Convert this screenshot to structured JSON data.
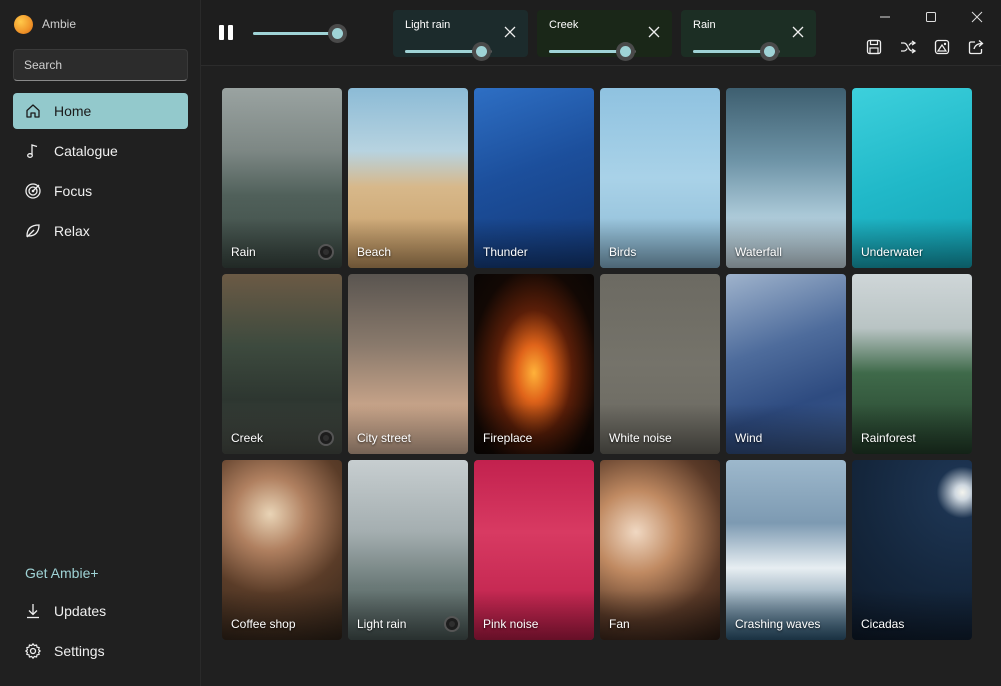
{
  "app": {
    "title": "Ambie"
  },
  "search": {
    "placeholder": "Search"
  },
  "nav": {
    "items": [
      {
        "label": "Home",
        "icon": "home-icon",
        "active": true
      },
      {
        "label": "Catalogue",
        "icon": "music-note-icon",
        "active": false
      },
      {
        "label": "Focus",
        "icon": "target-icon",
        "active": false
      },
      {
        "label": "Relax",
        "icon": "leaf-icon",
        "active": false
      }
    ],
    "get_plus": "Get Ambie+",
    "updates": "Updates",
    "settings": "Settings"
  },
  "player": {
    "state": "playing",
    "master_volume": 0.95,
    "active_sounds": [
      {
        "label": "Light rain",
        "volume": 0.87
      },
      {
        "label": "Creek",
        "volume": 0.87
      },
      {
        "label": "Rain",
        "volume": 0.87
      }
    ]
  },
  "colors": {
    "accent": "#93c9cc",
    "accent_light": "#9fd3d6",
    "background": "#202020"
  },
  "sounds": [
    {
      "name": "Rain",
      "playing": true,
      "bg": "linear-gradient(180deg,#9aa3a1 0%,#7d8784 35%,#50605a 60%,#3c4a44 100%)"
    },
    {
      "name": "Beach",
      "playing": false,
      "bg": "linear-gradient(180deg,#8cbbd6 0%,#b7d3e0 35%,#d7b88a 55%,#c69a63 100%)"
    },
    {
      "name": "Thunder",
      "playing": false,
      "bg": "linear-gradient(160deg,#2e6fc4 0%,#1c4f9c 45%,#143a7a 100%)"
    },
    {
      "name": "Birds",
      "playing": false,
      "bg": "linear-gradient(180deg,#8fc2e0 0%,#a9d2e8 50%,#8bb9d4 100%)"
    },
    {
      "name": "Waterfall",
      "playing": false,
      "bg": "linear-gradient(180deg,#3e5f70 0%,#6d93a6 40%,#a9c7d6 70%,#cfe1ea 100%)"
    },
    {
      "name": "Underwater",
      "playing": false,
      "bg": "linear-gradient(160deg,#3dd0dc 0%,#21b9c9 50%,#13a3b5 100%)"
    },
    {
      "name": "Creek",
      "playing": true,
      "bg": "linear-gradient(180deg,#6b5a45 0%,#3d4a3e 40%,#2d3630 70%,#4a4f48 100%)"
    },
    {
      "name": "City street",
      "playing": false,
      "bg": "linear-gradient(180deg,#5a5550 0%,#8a7a6c 40%,#c9a58a 75%,#d6b49b 100%)"
    },
    {
      "name": "Fireplace",
      "playing": false,
      "bg": "radial-gradient(ellipse at 50% 55%,#ffb23a 0%,#e0641a 20%,#5a1e08 45%,#120804 75%,#0a0604 100%)"
    },
    {
      "name": "White noise",
      "playing": false,
      "bg": "linear-gradient(180deg,#6c6a62 0%,#75736a 50%,#6a6860 100%)"
    },
    {
      "name": "Wind",
      "playing": false,
      "bg": "linear-gradient(160deg,#9fb3cc 0%,#4e6c9c 40%,#2e4b80 70%,#3c5a8c 100%)"
    },
    {
      "name": "Rainforest",
      "playing": false,
      "bg": "linear-gradient(180deg,#cfd6d8 0%,#b9c4c4 30%,#3f6a4a 55%,#233e2a 100%)"
    },
    {
      "name": "Coffee shop",
      "playing": false,
      "bg": "radial-gradient(circle at 40% 30%,#e9d4b6 0%,#b08060 25%,#5a3c28 55%,#2e2218 100%)"
    },
    {
      "name": "Light rain",
      "playing": true,
      "bg": "linear-gradient(180deg,#c7ced0 0%,#a4aeb0 40%,#6b7a78 70%,#4a5856 100%)"
    },
    {
      "name": "Pink noise",
      "playing": false,
      "bg": "linear-gradient(180deg,#c2214e 0%,#d83a62 40%,#b81c47 100%)"
    },
    {
      "name": "Fan",
      "playing": false,
      "bg": "radial-gradient(circle at 30% 40%,#f0d8c2 0%,#c08a62 30%,#5a3a28 65%,#2a1a12 100%)"
    },
    {
      "name": "Crashing waves",
      "playing": false,
      "bg": "linear-gradient(180deg,#9db8cc 0%,#7d9ab2 35%,#e7eef2 60%,#2f5a78 100%)"
    },
    {
      "name": "Cicadas",
      "playing": false,
      "bg": "radial-gradient(circle at 92% 18%,#f4f4ee 0%,#cfd8e0 4%,#1c3350 14%,#14263c 55%,#0e1a2a 100%)"
    }
  ]
}
